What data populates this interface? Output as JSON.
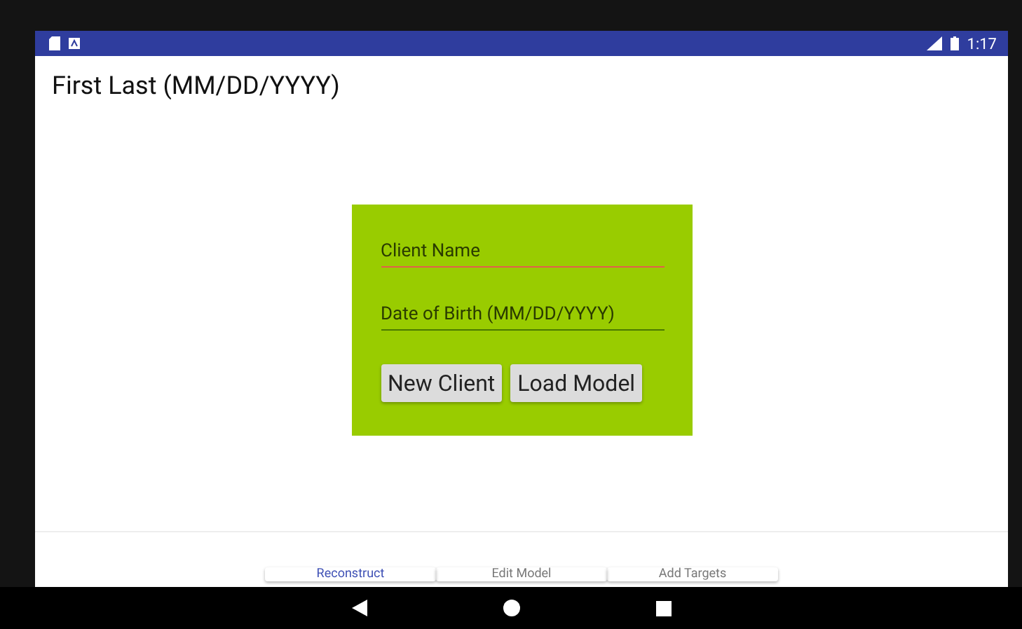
{
  "status_bar": {
    "time": "1:17"
  },
  "header": {
    "title": "First Last (MM/DD/YYYY)"
  },
  "form": {
    "fields": [
      {
        "placeholder": "Client Name",
        "focused": true
      },
      {
        "placeholder": "Date of Birth (MM/DD/YYYY)",
        "focused": false
      }
    ],
    "buttons": [
      "New Client",
      "Load Model"
    ]
  },
  "tabs": [
    {
      "label": "Reconstruct",
      "selected": true
    },
    {
      "label": "Edit Model",
      "selected": false
    },
    {
      "label": "Add Targets",
      "selected": false
    }
  ]
}
